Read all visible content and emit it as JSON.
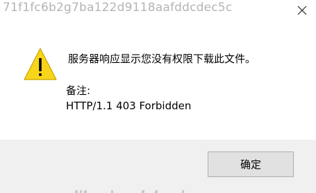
{
  "window": {
    "title": "71f1fc6b2g7ba122d9118aafddcdec5c",
    "close_icon": "close-icon"
  },
  "content": {
    "icon": "warning-icon",
    "message": "服务器响应显示您没有权限下载此文件。",
    "note_label": "备注:",
    "note_value": "HTTP/1.1 403 Forbidden"
  },
  "footer": {
    "ok_label": "确定"
  },
  "colors": {
    "warning_fill": "#f8d51a",
    "footer_bg": "#f0f0f0",
    "button_bg": "#e1e1e1",
    "button_border": "#adadad"
  }
}
